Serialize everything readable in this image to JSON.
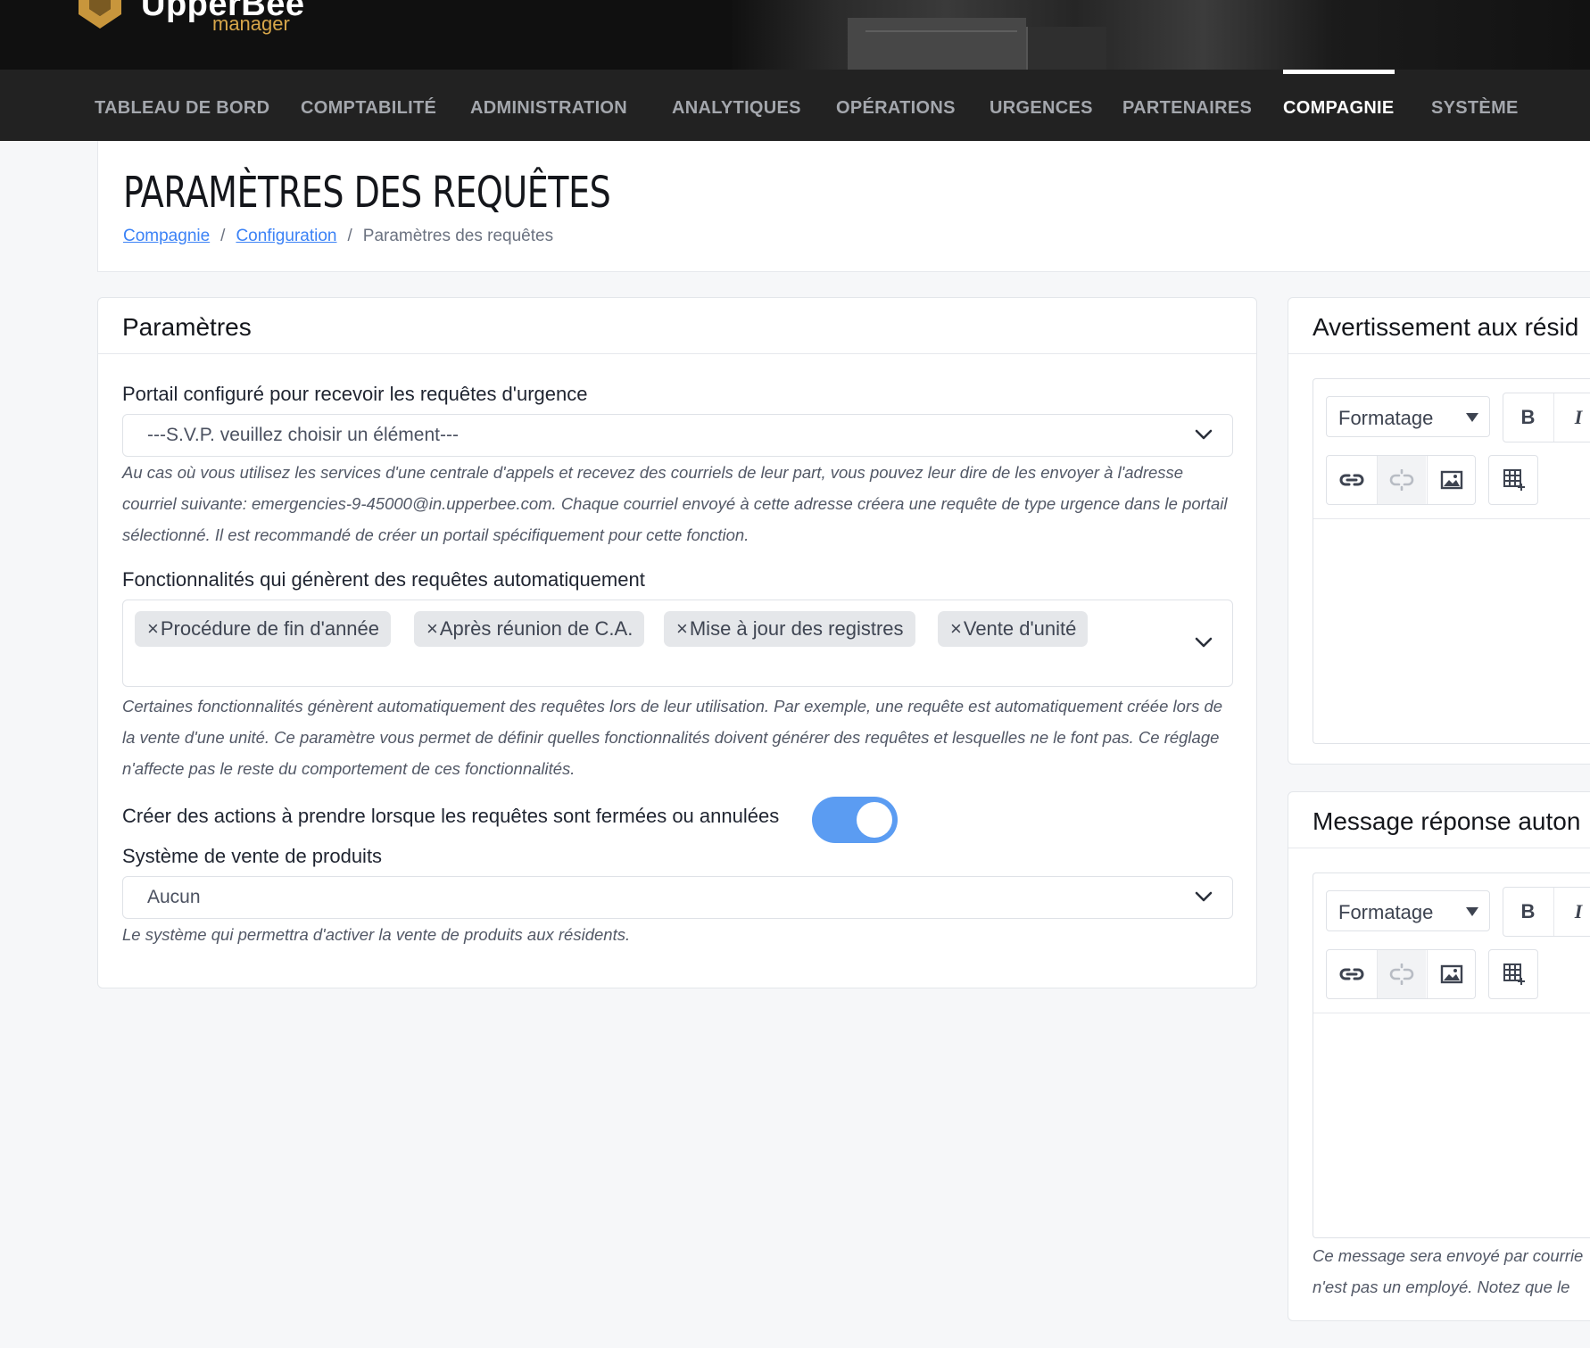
{
  "header": {
    "brand_name": "UpperBee",
    "brand_sub": "manager"
  },
  "nav": {
    "items": [
      {
        "label": "TABLEAU DE BORD"
      },
      {
        "label": "COMPTABILITÉ"
      },
      {
        "label": "ADMINISTRATION"
      },
      {
        "label": "ANALYTIQUES"
      },
      {
        "label": "OPÉRATIONS"
      },
      {
        "label": "URGENCES"
      },
      {
        "label": "PARTENAIRES"
      },
      {
        "label": "COMPAGNIE",
        "active": true
      },
      {
        "label": "SYSTÈME"
      }
    ]
  },
  "page": {
    "title": "PARAMÈTRES DES REQUÊTES",
    "breadcrumb": [
      "Compagnie",
      "Configuration",
      "Paramètres des requêtes"
    ],
    "breadcrumb_sep": "/"
  },
  "settings": {
    "title": "Paramètres",
    "portal_label": "Portail configuré pour recevoir les requêtes d'urgence",
    "portal_value": "---S.V.P. veuillez choisir un élément---",
    "portal_help": "Au cas où vous utilisez les services d'une centrale d'appels et recevez des courriels de leur part, vous pouvez leur dire de les envoyer à l'adresse courriel suivante: emergencies-9-45000@in.upperbee.com. Chaque courriel envoyé à cette adresse créera une requête de type urgence dans le portail sélectionné. Il est recommandé de créer un portail spécifiquement pour cette fonction.",
    "features_label": "Fonctionnalités qui génèrent des requêtes automatiquement",
    "features_chip_remove": "×",
    "features_chips": [
      "Procédure de fin d'année",
      "Après réunion de C.A.",
      "Mise à jour des registres",
      "Vente d'unité"
    ],
    "features_help": "Certaines fonctionnalités génèrent automatiquement des requêtes lors de leur utilisation. Par exemple, une requête est automatiquement créée lors de la vente d'une unité. Ce paramètre vous permet de définir quelles fonctionnalités doivent générer des requêtes et lesquelles ne le font pas. Ce réglage n'affecte pas le reste du comportement de ces fonctionnalités.",
    "actions_label": "Créer des actions à prendre lorsque les requêtes sont fermées ou annulées",
    "actions_enabled": true,
    "sales_label": "Système de vente de produits",
    "sales_value": "Aucun",
    "sales_help": "Le système qui permettra d'activer la vente de produits aux résidents."
  },
  "warning_card": {
    "title": "Avertissement aux résid",
    "format_label": "Formatage",
    "bold": "B",
    "italic": "I"
  },
  "autoreply_card": {
    "title": "Message réponse auton",
    "format_label": "Formatage",
    "bold": "B",
    "italic": "I",
    "help_line1": "Ce message sera envoyé par courrie",
    "help_line2": "n'est pas un employé. Notez que le"
  },
  "colors": {
    "accent": "#3b82f6",
    "toggle_on": "#5b9cf2",
    "nav_bg": "#222222",
    "brand_gold": "#d7a64a"
  }
}
